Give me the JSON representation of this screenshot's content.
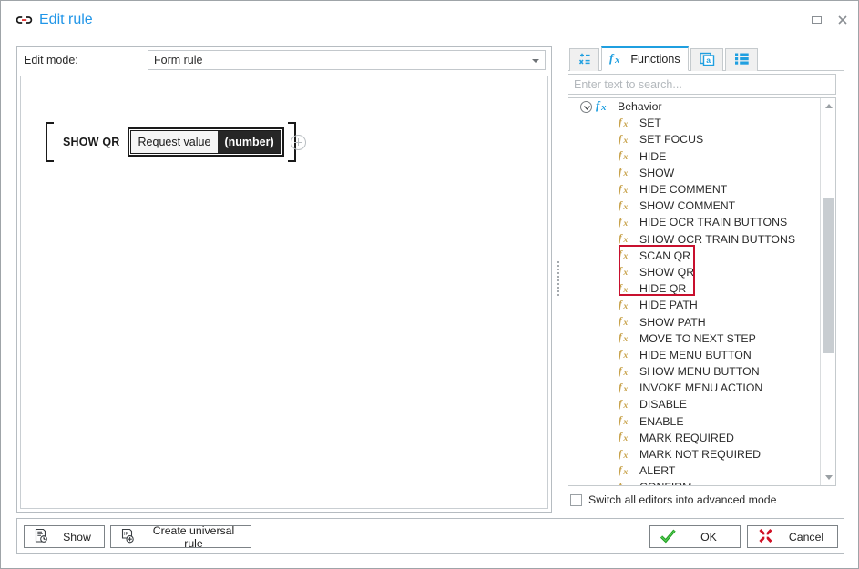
{
  "window": {
    "title": "Edit rule",
    "title_icon": "link-chain-icon",
    "accent_color": "#2196e8",
    "controls": [
      {
        "name": "maximize",
        "icon": "maximize-icon"
      },
      {
        "name": "close",
        "icon": "close-icon"
      }
    ]
  },
  "left": {
    "edit_mode_label": "Edit mode:",
    "edit_mode_value": "Form rule",
    "edit_mode_options": [
      "Form rule"
    ],
    "rule": {
      "keyword": "SHOW QR",
      "param_label": "Request value",
      "param_type": "(number)"
    },
    "add_button_icon": "plus-circle-icon"
  },
  "right": {
    "tabs": [
      {
        "id": "variables",
        "label": "",
        "icon": "math-variables-icon",
        "active": false
      },
      {
        "id": "functions",
        "label": "Functions",
        "icon": "fx-icon",
        "active": true
      },
      {
        "id": "attributes",
        "label": "",
        "icon": "stacked-pages-a-icon",
        "active": false
      },
      {
        "id": "lists",
        "label": "",
        "icon": "list-items-icon",
        "active": false
      }
    ],
    "search": {
      "placeholder": "Enter text to search...",
      "value": ""
    },
    "tree": {
      "root": {
        "label": "Behavior",
        "icon": "fx-icon",
        "expanded": true
      },
      "items": [
        {
          "label": "SET",
          "highlighted": false
        },
        {
          "label": "SET FOCUS",
          "highlighted": false
        },
        {
          "label": "HIDE",
          "highlighted": false
        },
        {
          "label": "SHOW",
          "highlighted": false
        },
        {
          "label": "HIDE COMMENT",
          "highlighted": false
        },
        {
          "label": "SHOW COMMENT",
          "highlighted": false
        },
        {
          "label": "HIDE OCR TRAIN BUTTONS",
          "highlighted": false
        },
        {
          "label": "SHOW OCR TRAIN BUTTONS",
          "highlighted": false
        },
        {
          "label": "SCAN QR",
          "highlighted": true
        },
        {
          "label": "SHOW QR",
          "highlighted": true
        },
        {
          "label": "HIDE QR",
          "highlighted": true
        },
        {
          "label": "HIDE PATH",
          "highlighted": false
        },
        {
          "label": "SHOW PATH",
          "highlighted": false
        },
        {
          "label": "MOVE TO NEXT STEP",
          "highlighted": false
        },
        {
          "label": "HIDE MENU BUTTON",
          "highlighted": false
        },
        {
          "label": "SHOW MENU BUTTON",
          "highlighted": false
        },
        {
          "label": "INVOKE MENU ACTION",
          "highlighted": false
        },
        {
          "label": "DISABLE",
          "highlighted": false
        },
        {
          "label": "ENABLE",
          "highlighted": false
        },
        {
          "label": "MARK REQUIRED",
          "highlighted": false
        },
        {
          "label": "MARK NOT REQUIRED",
          "highlighted": false
        },
        {
          "label": "ALERT",
          "highlighted": false
        },
        {
          "label": "CONFIRM",
          "highlighted": false
        }
      ],
      "highlight_color": "#c8102e"
    },
    "advanced_checkbox": {
      "label": "Switch all editors into advanced mode",
      "checked": false
    }
  },
  "bottom": {
    "show_label": "Show",
    "show_icon": "document-refresh-icon",
    "universal_label": "Create universal rule",
    "universal_icon": "if-plus-icon",
    "ok_label": "OK",
    "ok_icon": "green-check-icon",
    "cancel_label": "Cancel",
    "cancel_icon": "red-cross-icon"
  }
}
